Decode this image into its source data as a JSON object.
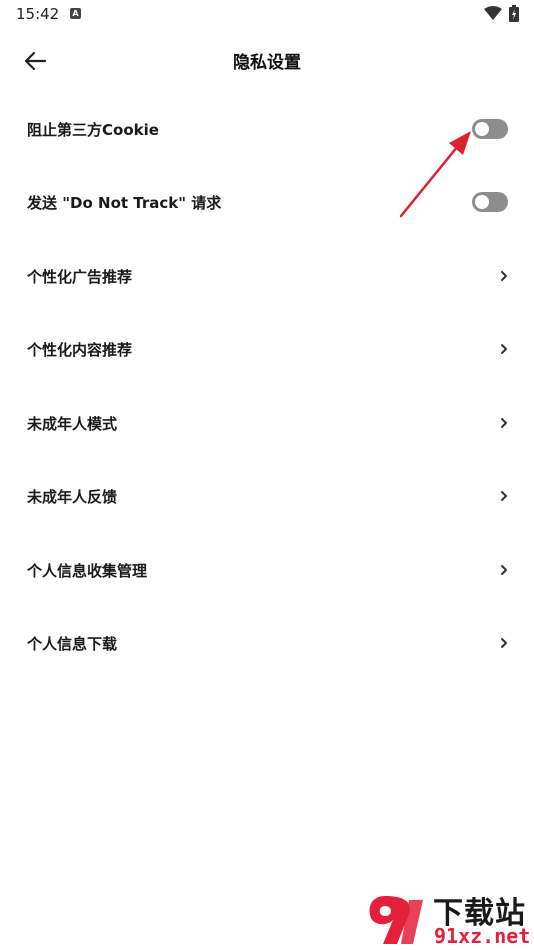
{
  "status_bar": {
    "time": "15:42"
  },
  "header": {
    "title": "隐私设置"
  },
  "settings": [
    {
      "label": "阻止第三方Cookie",
      "control": "toggle",
      "on": false
    },
    {
      "label": "发送 \"Do Not Track\" 请求",
      "control": "toggle",
      "on": false
    },
    {
      "label": "个性化广告推荐",
      "control": "chevron"
    },
    {
      "label": "个性化内容推荐",
      "control": "chevron"
    },
    {
      "label": "未成年人模式",
      "control": "chevron"
    },
    {
      "label": "未成年人反馈",
      "control": "chevron"
    },
    {
      "label": "个人信息收集管理",
      "control": "chevron"
    },
    {
      "label": "个人信息下载",
      "control": "chevron"
    }
  ],
  "watermark": {
    "cn": "下载站",
    "url": "91xz.net"
  },
  "colors": {
    "toggle_off": "#8d8d8d",
    "annotation": "#e0202a",
    "watermark_red": "#e4203a"
  }
}
